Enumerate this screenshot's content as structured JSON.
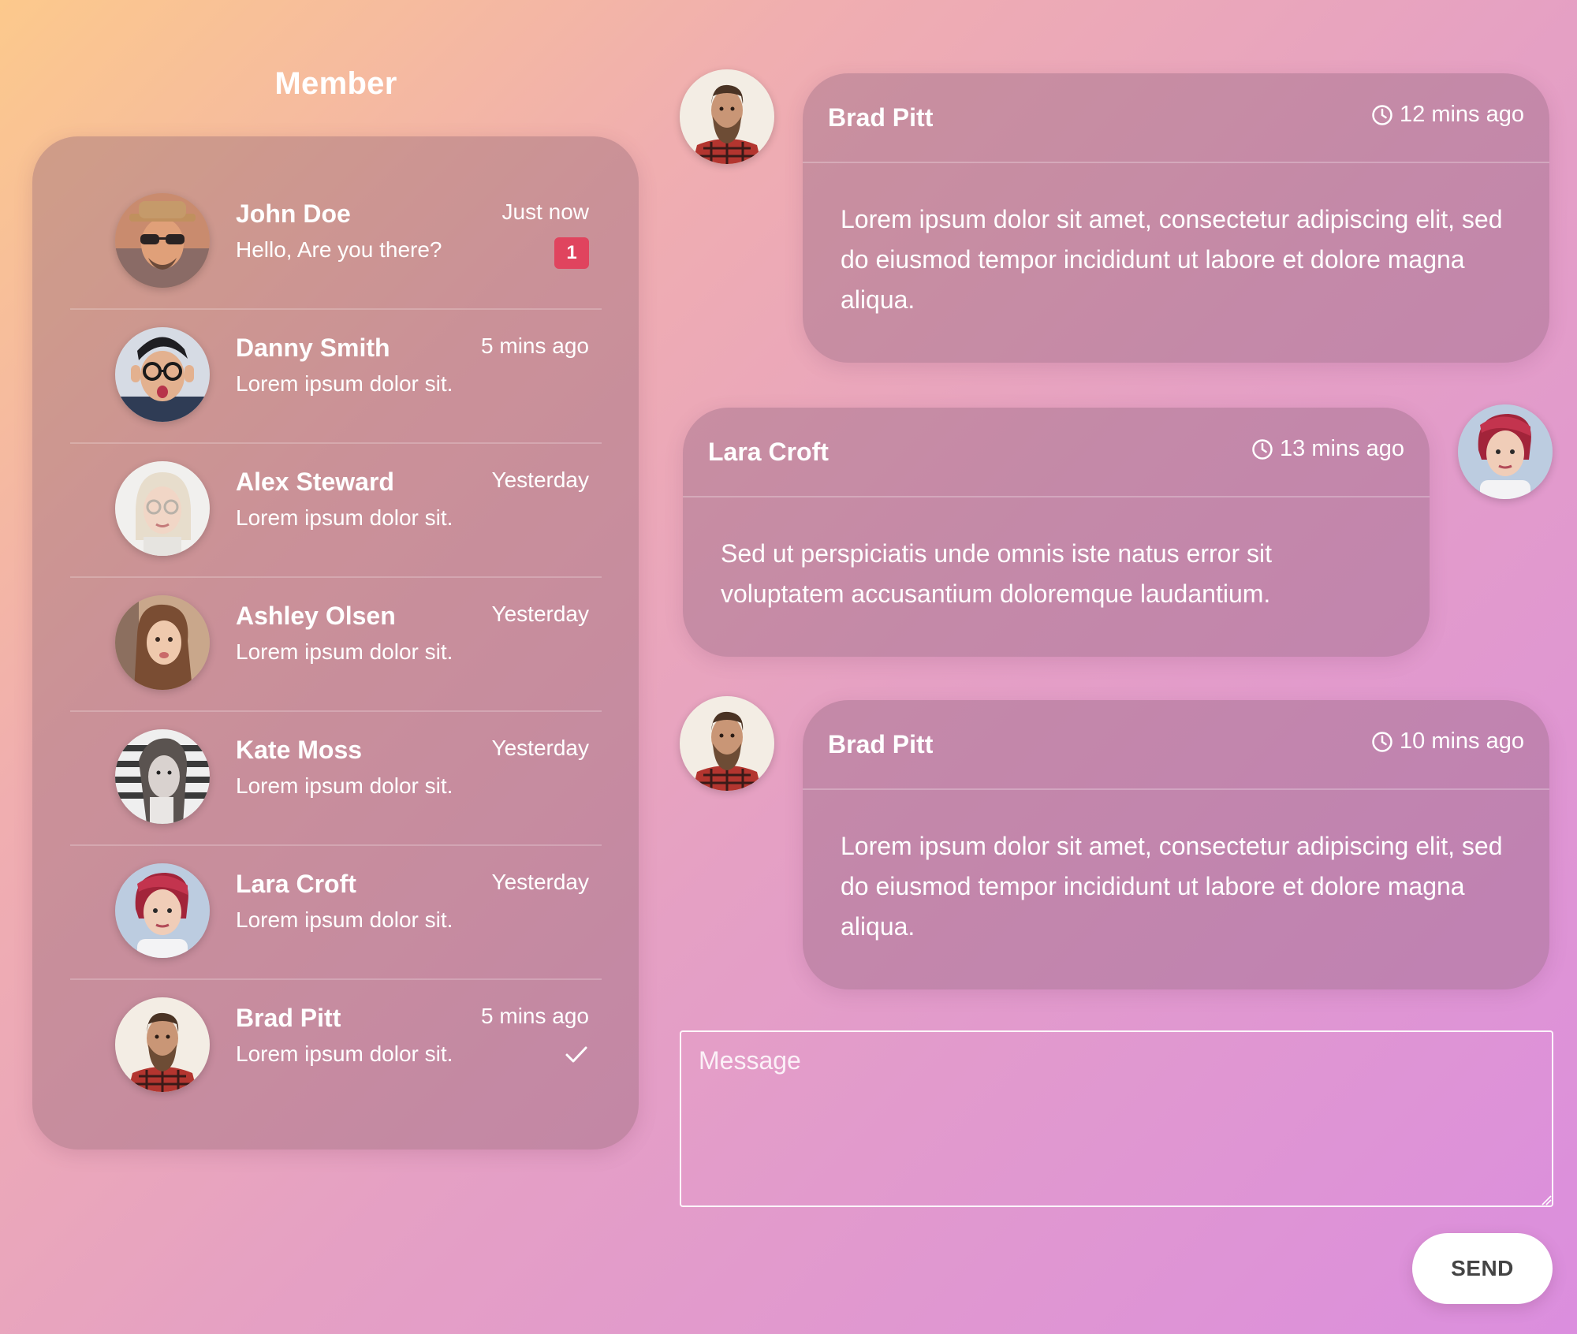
{
  "sidebar": {
    "title": "Member",
    "members": [
      {
        "name": "John Doe",
        "preview": "Hello, Are you there?",
        "time": "Just now",
        "badge": "1",
        "avatar": "john-doe"
      },
      {
        "name": "Danny Smith",
        "preview": "Lorem ipsum dolor sit.",
        "time": "5 mins ago",
        "avatar": "danny-smith"
      },
      {
        "name": "Alex Steward",
        "preview": "Lorem ipsum dolor sit.",
        "time": "Yesterday",
        "avatar": "alex-steward"
      },
      {
        "name": "Ashley Olsen",
        "preview": "Lorem ipsum dolor sit.",
        "time": "Yesterday",
        "avatar": "ashley-olsen"
      },
      {
        "name": "Kate Moss",
        "preview": "Lorem ipsum dolor sit.",
        "time": "Yesterday",
        "avatar": "kate-moss"
      },
      {
        "name": "Lara Croft",
        "preview": "Lorem ipsum dolor sit.",
        "time": "Yesterday",
        "avatar": "lara-croft"
      },
      {
        "name": "Brad Pitt",
        "preview": "Lorem ipsum dolor sit.",
        "time": "5 mins ago",
        "read_icon": "check-icon",
        "avatar": "brad-pitt"
      }
    ]
  },
  "chat": {
    "messages": [
      {
        "sender": "Brad Pitt",
        "time": "12 mins ago",
        "time_icon": "clock-icon",
        "side": "left",
        "text": "Lorem ipsum dolor sit amet, consectetur adipiscing elit, sed do eiusmod tempor incididunt ut labore et dolore magna aliqua."
      },
      {
        "sender": "Lara Croft",
        "time": "13 mins ago",
        "time_icon": "clock-icon",
        "side": "right",
        "text": "Sed ut perspiciatis unde omnis iste natus error sit voluptatem accusantium doloremque laudantium."
      },
      {
        "sender": "Brad Pitt",
        "time": "10 mins ago",
        "time_icon": "clock-icon",
        "side": "left",
        "text": "Lorem ipsum dolor sit amet, consectetur adipiscing elit, sed do eiusmod tempor incididunt ut labore et dolore magna aliqua."
      }
    ]
  },
  "composer": {
    "placeholder": "Message",
    "send_label": "SEND"
  },
  "colors": {
    "background_start": "#fcc98c",
    "background_end": "#db8ede",
    "badge": "#e0445e",
    "send_button": "#ffffff"
  }
}
